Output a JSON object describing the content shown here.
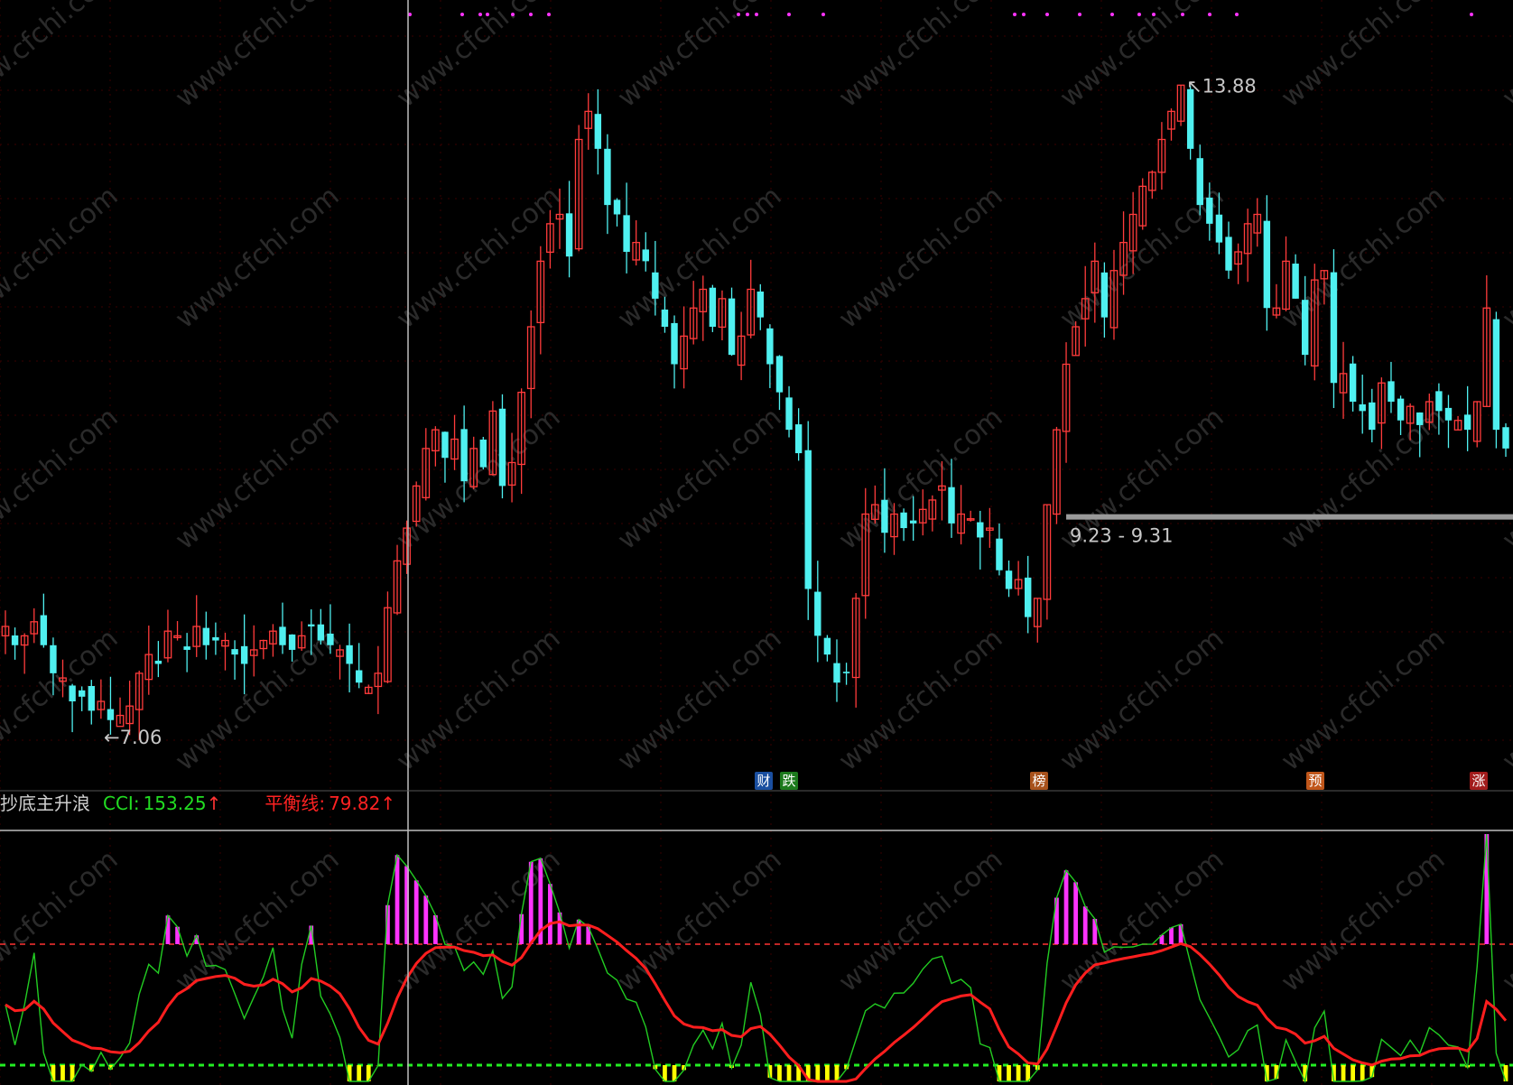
{
  "main_title_partial": "(…)",
  "indicator": {
    "name": "抄底主升浪",
    "cci_label": "CCI:",
    "cci_value": "153.25",
    "balance_label": "平衡线:",
    "balance_value": "79.82",
    "up_arrow": "↑"
  },
  "annotations": {
    "high_label": "13.88",
    "low_label": "7.06",
    "range_label": "9.23 - 9.31"
  },
  "event_badges": [
    {
      "text": "财",
      "color": "#1a4fa0"
    },
    {
      "text": "跌",
      "color": "#1d7a1d"
    },
    {
      "text": "榜",
      "color": "#a8521c"
    },
    {
      "text": "预",
      "color": "#c0561a"
    },
    {
      "text": "涨",
      "color": "#a21c1c"
    }
  ],
  "colors": {
    "up_candle": "#ff3b3b",
    "down_candle": "#4ff0f0",
    "cci_line": "#22cc22",
    "balance_line": "#ff1e1e",
    "histogram_pos": "#ff33ff",
    "histogram_neg": "#ffff00",
    "level_high": "#ff3333",
    "level_low": "#22ee22",
    "grid": "#3a0000"
  },
  "chart_data": [
    {
      "type": "candlestick",
      "title": "",
      "ylim": [
        6.5,
        14.5
      ],
      "high": 13.88,
      "low": 7.06,
      "range_line": [
        9.23,
        9.31
      ],
      "ohlc_desc": "approximate daily closes",
      "close": [
        8.1,
        7.9,
        8.0,
        8.15,
        7.9,
        7.6,
        7.55,
        7.3,
        7.35,
        7.2,
        7.3,
        7.1,
        7.15,
        7.25,
        7.6,
        7.8,
        7.7,
        8.05,
        8.0,
        7.85,
        8.1,
        7.9,
        7.95,
        7.95,
        7.8,
        7.7,
        7.85,
        7.95,
        8.05,
        7.9,
        7.85,
        8.0,
        8.1,
        7.95,
        7.9,
        7.85,
        7.7,
        7.5,
        7.45,
        7.6,
        8.3,
        8.8,
        9.15,
        9.6,
        10.0,
        10.2,
        9.9,
        10.1,
        9.65,
        10.0,
        9.8,
        10.4,
        9.6,
        9.85,
        10.6,
        11.3,
        12.0,
        12.4,
        12.5,
        12.05,
        13.3,
        13.6,
        13.2,
        12.6,
        12.5,
        12.1,
        12.2,
        12.0,
        11.6,
        11.3,
        10.9,
        11.2,
        11.5,
        11.7,
        11.3,
        11.6,
        11.0,
        11.2,
        11.7,
        11.4,
        10.9,
        10.6,
        10.2,
        9.95,
        8.5,
        8.0,
        7.8,
        7.5,
        7.6,
        8.4,
        9.3,
        9.4,
        9.1,
        9.3,
        9.15,
        9.2,
        9.35,
        9.45,
        9.6,
        9.2,
        9.3,
        9.25,
        9.05,
        9.15,
        8.7,
        8.5,
        8.6,
        8.2,
        8.4,
        9.4,
        10.2,
        10.9,
        11.3,
        11.6,
        12.0,
        11.4,
        11.9,
        12.2,
        12.5,
        12.8,
        12.95,
        13.3,
        13.6,
        13.88,
        13.2,
        12.6,
        12.4,
        12.2,
        11.9,
        12.1,
        12.4,
        12.5,
        11.5,
        11.5,
        12.0,
        11.6,
        11.0,
        11.8,
        11.9,
        10.7,
        10.8,
        10.5,
        10.4,
        10.2,
        10.7,
        10.5,
        10.3,
        10.45,
        10.25,
        10.5,
        10.4,
        10.3,
        10.3,
        10.2,
        10.5,
        11.5,
        10.2,
        10.0
      ]
    },
    {
      "type": "line",
      "title": "抄底主升浪",
      "series": [
        {
          "name": "CCI",
          "last": 153.25
        },
        {
          "name": "平衡线",
          "last": 79.82
        }
      ],
      "levels": [
        100,
        -100
      ]
    }
  ]
}
